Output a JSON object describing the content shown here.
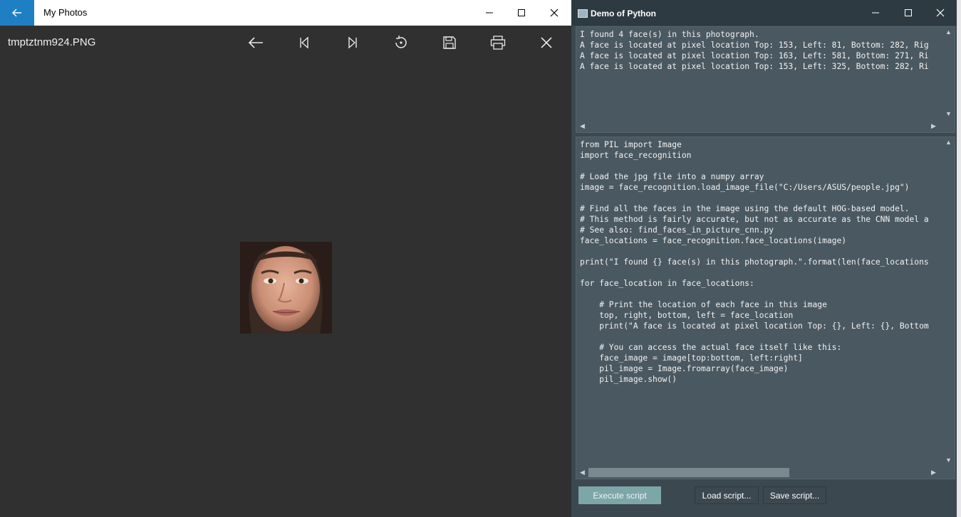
{
  "photos": {
    "app_title": "My Photos",
    "filename": "tmptztnm924.PNG",
    "toolbar": [
      "back-arrow-icon",
      "first-icon",
      "last-icon",
      "rotate-icon",
      "save-icon",
      "print-icon",
      "close-icon"
    ]
  },
  "python": {
    "title": "Demo of Python",
    "output": "I found 4 face(s) in this photograph.\nA face is located at pixel location Top: 153, Left: 81, Bottom: 282, Rig\nA face is located at pixel location Top: 163, Left: 581, Bottom: 271, Ri\nA face is located at pixel location Top: 153, Left: 325, Bottom: 282, Ri",
    "script": "from PIL import Image\nimport face_recognition\n\n# Load the jpg file into a numpy array\nimage = face_recognition.load_image_file(\"C:/Users/ASUS/people.jpg\")\n\n# Find all the faces in the image using the default HOG-based model.\n# This method is fairly accurate, but not as accurate as the CNN model a\n# See also: find_faces_in_picture_cnn.py\nface_locations = face_recognition.face_locations(image)\n\nprint(\"I found {} face(s) in this photograph.\".format(len(face_locations\n\nfor face_location in face_locations:\n\n    # Print the location of each face in this image\n    top, right, bottom, left = face_location\n    print(\"A face is located at pixel location Top: {}, Left: {}, Bottom\n\n    # You can access the actual face itself like this:\n    face_image = image[top:bottom, left:right]\n    pil_image = Image.fromarray(face_image)\n    pil_image.show()",
    "buttons": {
      "execute": "Execute script",
      "load": "Load script...",
      "save": "Save script..."
    }
  },
  "colors": {
    "accent": "#1f7fc4",
    "execute_bg": "#7da6a8",
    "pane_bg": "#4a5861"
  }
}
